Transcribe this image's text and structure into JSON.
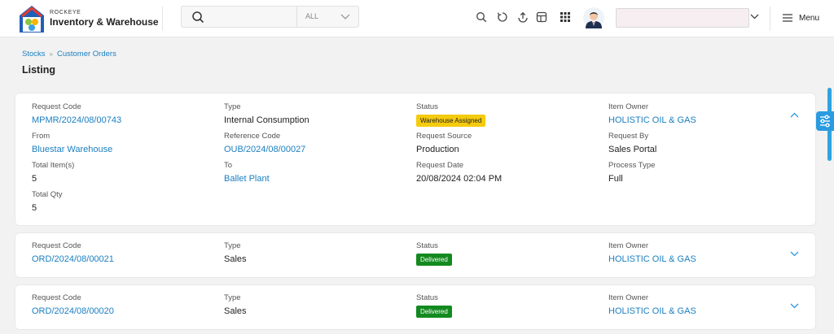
{
  "header": {
    "brand_small": "ROCKEYE",
    "brand_title": "Inventory & Warehouse",
    "search_placeholder": "",
    "search_filter": "ALL",
    "menu_label": "Menu"
  },
  "breadcrumb": {
    "items": [
      "Stocks",
      "Customer Orders"
    ]
  },
  "page_title": "Listing",
  "cards": [
    {
      "request_code_label": "Request Code",
      "request_code": "MPMR/2024/08/00743",
      "type_label": "Type",
      "type": "Internal Consumption",
      "status_label": "Status",
      "status": "Warehouse Assigned",
      "item_owner_label": "Item Owner",
      "item_owner": "HOLISTIC OIL & GAS",
      "from_label": "From",
      "from": "Bluestar Warehouse",
      "reference_code_label": "Reference Code",
      "reference_code": "OUB/2024/08/00027",
      "request_source_label": "Request Source",
      "request_source": "Production",
      "request_by_label": "Request By",
      "request_by": "Sales Portal",
      "total_items_label": "Total Item(s)",
      "total_items": "5",
      "to_label": "To",
      "to": "Ballet Plant",
      "request_date_label": "Request Date",
      "request_date": "20/08/2024 02:04 PM",
      "process_type_label": "Process Type",
      "process_type": "Full",
      "total_qty_label": "Total Qty",
      "total_qty": "5"
    },
    {
      "request_code_label": "Request Code",
      "request_code": "ORD/2024/08/00021",
      "type_label": "Type",
      "type": "Sales",
      "status_label": "Status",
      "status": "Delivered",
      "item_owner_label": "Item Owner",
      "item_owner": "HOLISTIC OIL & GAS"
    },
    {
      "request_code_label": "Request Code",
      "request_code": "ORD/2024/08/00020",
      "type_label": "Type",
      "type": "Sales",
      "status_label": "Status",
      "status": "Delivered",
      "item_owner_label": "Item Owner",
      "item_owner": "HOLISTIC OIL & GAS"
    }
  ],
  "colors": {
    "accent": "#1a7fc1",
    "warning_badge": "#f5cb0d",
    "success_badge": "#138a1f",
    "side_tab": "#2a9be0"
  },
  "icons": [
    "search-icon",
    "chevron-down-icon",
    "refresh-icon",
    "upload-icon",
    "table-icon",
    "apps-grid-icon",
    "hamburger-icon",
    "chevron-up-icon",
    "filter-sliders-icon"
  ]
}
